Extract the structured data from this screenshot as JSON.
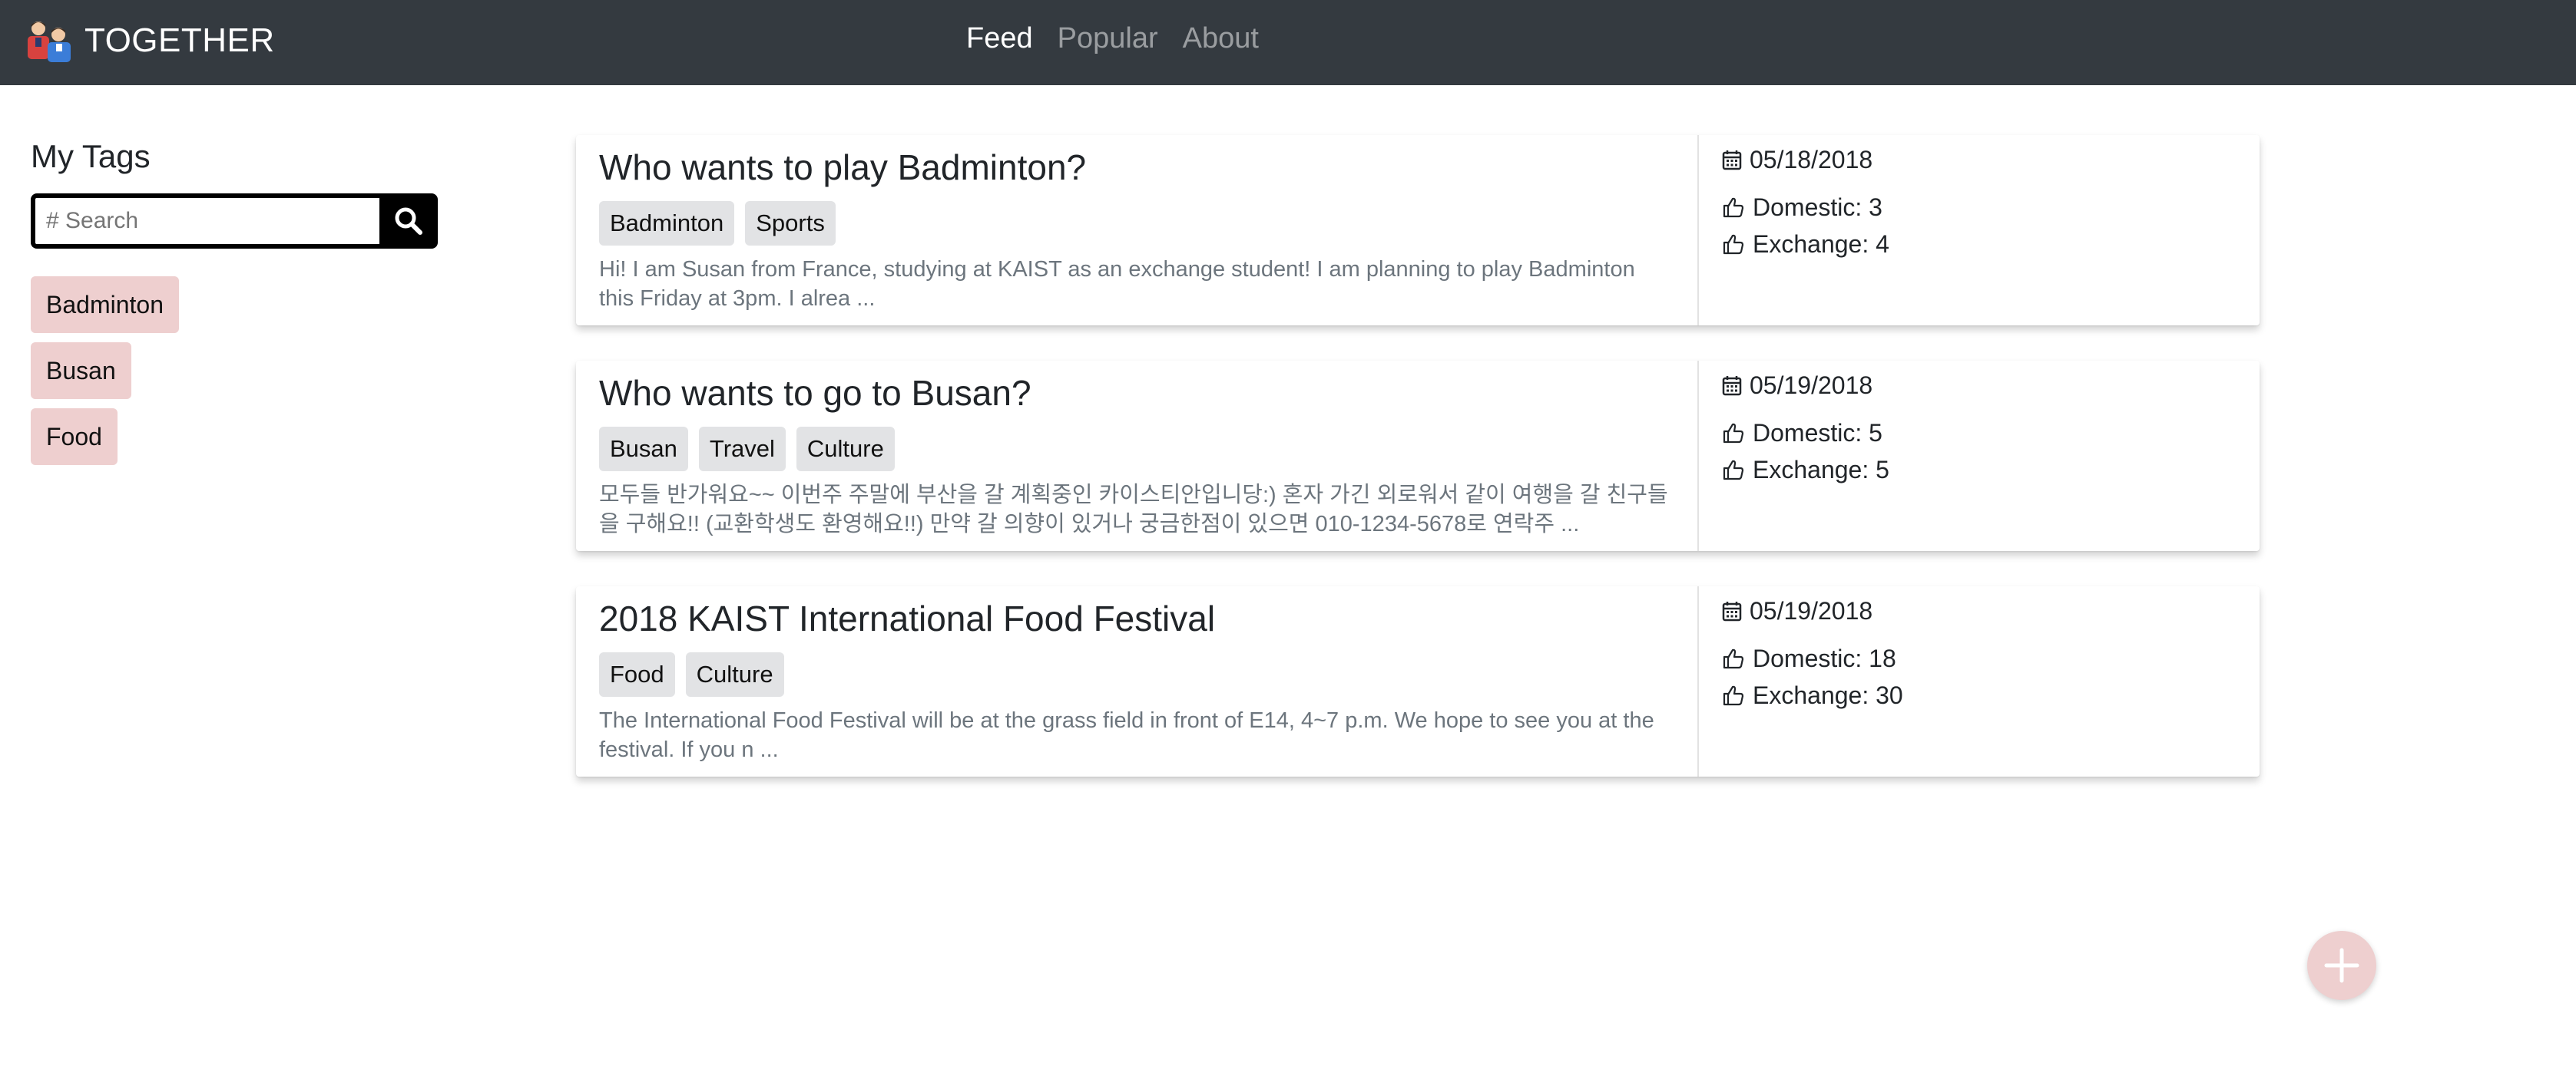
{
  "nav": {
    "brand": "TOGETHER",
    "links": [
      "Feed",
      "Popular",
      "About"
    ]
  },
  "sidebar": {
    "title": "My Tags",
    "search_placeholder": "# Search",
    "tags": [
      "Badminton",
      "Busan",
      "Food"
    ]
  },
  "feed": {
    "posts": [
      {
        "title": "Who wants to play Badminton?",
        "tags": [
          "Badminton",
          "Sports"
        ],
        "excerpt": "Hi! I am Susan from France, studying at KAIST as an exchange student! I am planning to play Badminton this Friday at 3pm. I alrea ...",
        "date": "05/18/2018",
        "domestic": "Domestic: 3",
        "exchange": "Exchange: 4"
      },
      {
        "title": "Who wants to go to Busan?",
        "tags": [
          "Busan",
          "Travel",
          "Culture"
        ],
        "excerpt": "모두들 반가워요~~ 이번주 주말에 부산을 갈 계획중인 카이스티안입니당:) 혼자 가긴 외로워서 같이 여행을 갈 친구들을 구해요!! (교환학생도 환영해요!!) 만약 갈 의향이 있거나 궁금한점이 있으면 010-1234-5678로 연락주 ...",
        "date": "05/19/2018",
        "domestic": "Domestic: 5",
        "exchange": "Exchange: 5"
      },
      {
        "title": "2018 KAIST International Food Festival",
        "tags": [
          "Food",
          "Culture"
        ],
        "excerpt": "The International Food Festival will be at the grass field in front of E14, 4~7 p.m. We hope to see you at the festival. If you n ...",
        "date": "05/19/2018",
        "domestic": "Domestic: 18",
        "exchange": "Exchange: 30"
      }
    ]
  },
  "colors": {
    "navbar": "#343a40",
    "tag_pink": "#eecfcf",
    "tag_gray": "#e2e3e5"
  },
  "icons": {
    "date": "calendar-icon",
    "like": "thumbs-up-icon",
    "search": "search-icon",
    "add": "plus-icon"
  }
}
